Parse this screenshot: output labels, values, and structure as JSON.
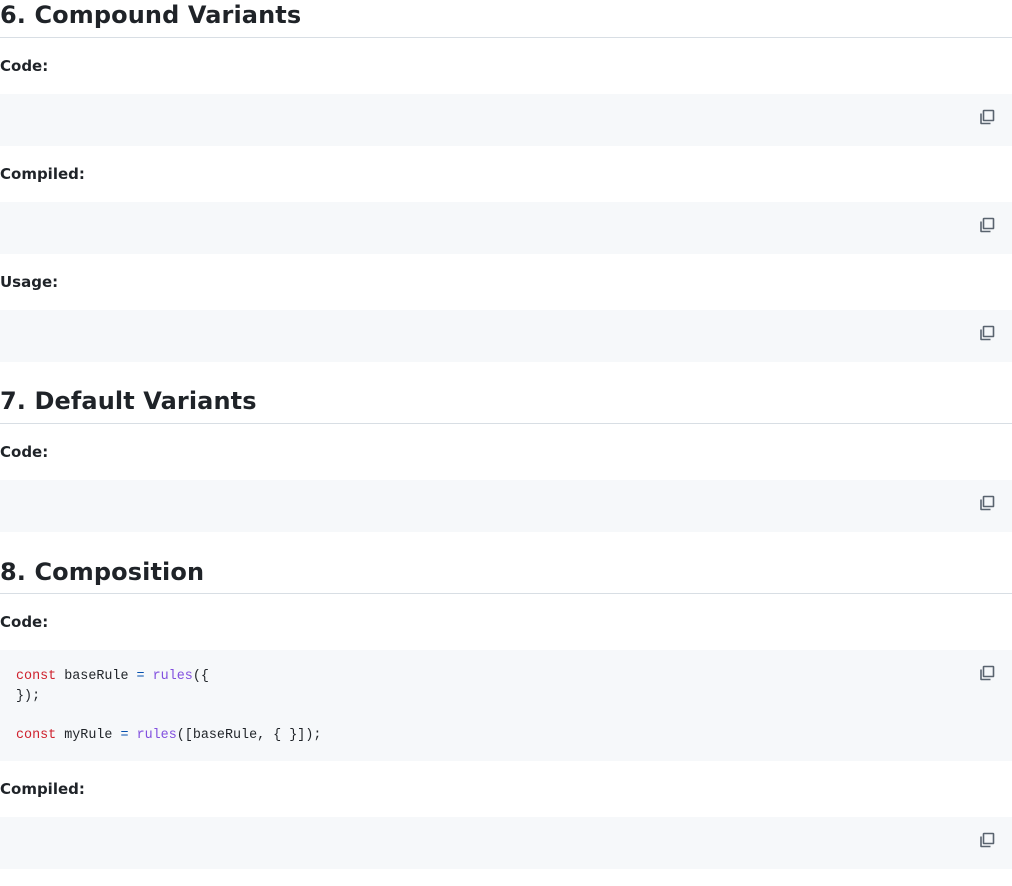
{
  "sections": {
    "s6": {
      "title": "6. Compound Variants",
      "labels": {
        "code": "Code:",
        "compiled": "Compiled:",
        "usage": "Usage:"
      }
    },
    "s7": {
      "title": "7. Default Variants",
      "labels": {
        "code": "Code:"
      }
    },
    "s8": {
      "title": "8. Composition",
      "labels": {
        "code": "Code:",
        "compiled": "Compiled:"
      },
      "code": {
        "line1": {
          "kw": "const",
          "name": " baseRule ",
          "op": "=",
          "fn": " rules",
          "rest": "({"
        },
        "line2": "});",
        "line3": {
          "kw": "const",
          "name": " myRule ",
          "op": "=",
          "fn": " rules",
          "rest": "([baseRule, { }]);"
        }
      }
    }
  },
  "icons": {
    "copy": "copy-icon"
  },
  "colors": {
    "code_bg": "#f6f8fa",
    "keyword": "#cf222e",
    "function": "#8250df",
    "operator": "#0550ae",
    "rule": "#d8dee4"
  }
}
